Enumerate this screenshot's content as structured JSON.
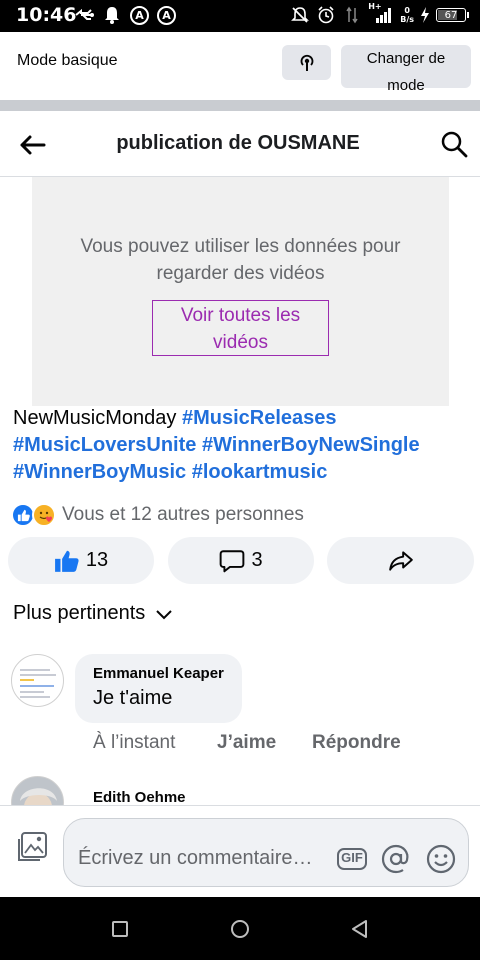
{
  "status_bar": {
    "time": "10:46",
    "left_icons": [
      "usb-icon",
      "notification-bell-icon",
      "a-circle-icon",
      "a-circle-icon"
    ],
    "a_badge": "A",
    "right_icons": [
      "mute-icon",
      "alarm-icon",
      "signal-icon",
      "network-speed-icon",
      "battery-icon"
    ],
    "network_speed_value": "0",
    "network_speed_unit": "B/s",
    "network_type": "H+",
    "battery_level": "67"
  },
  "mode_bar": {
    "label": "Mode basique",
    "change_mode_line1": "Changer de",
    "change_mode_line2": "mode"
  },
  "header": {
    "title": "publication de OUSMANE"
  },
  "video_notice": {
    "message_line1": "Vous pouvez utiliser les données pour",
    "message_line2": "regarder des vidéos",
    "button_line1": "Voir toutes les",
    "button_line2": "vidéos"
  },
  "post": {
    "text_prefix": "NewMusicMonday ",
    "hashtags": [
      "#MusicReleases",
      "#MusicLoversUnite",
      "#WinnerBoyNewSingle",
      "#WinnerBoyMusic",
      "#lookartmusic"
    ]
  },
  "reactions": {
    "summary": "Vous et 12 autres personnes"
  },
  "actions": {
    "like_count": "13",
    "comment_count": "3"
  },
  "sort": {
    "label": "Plus pertinents"
  },
  "comments": [
    {
      "author": "Emmanuel Keaper",
      "text": "Je t'aime",
      "time": "À l’instant",
      "like_label": "J’aime",
      "reply_label": "Répondre"
    },
    {
      "author": "Edith Oehme"
    }
  ],
  "composer": {
    "placeholder": "Écrivez un commentaire…",
    "gif_label": "GIF"
  },
  "colors": {
    "hashtag": "#216fdb",
    "video_button": "#9b2bb0",
    "like_blue": "#1877f2",
    "secondary_text": "#65676b",
    "button_bg": "#f0f2f5"
  }
}
